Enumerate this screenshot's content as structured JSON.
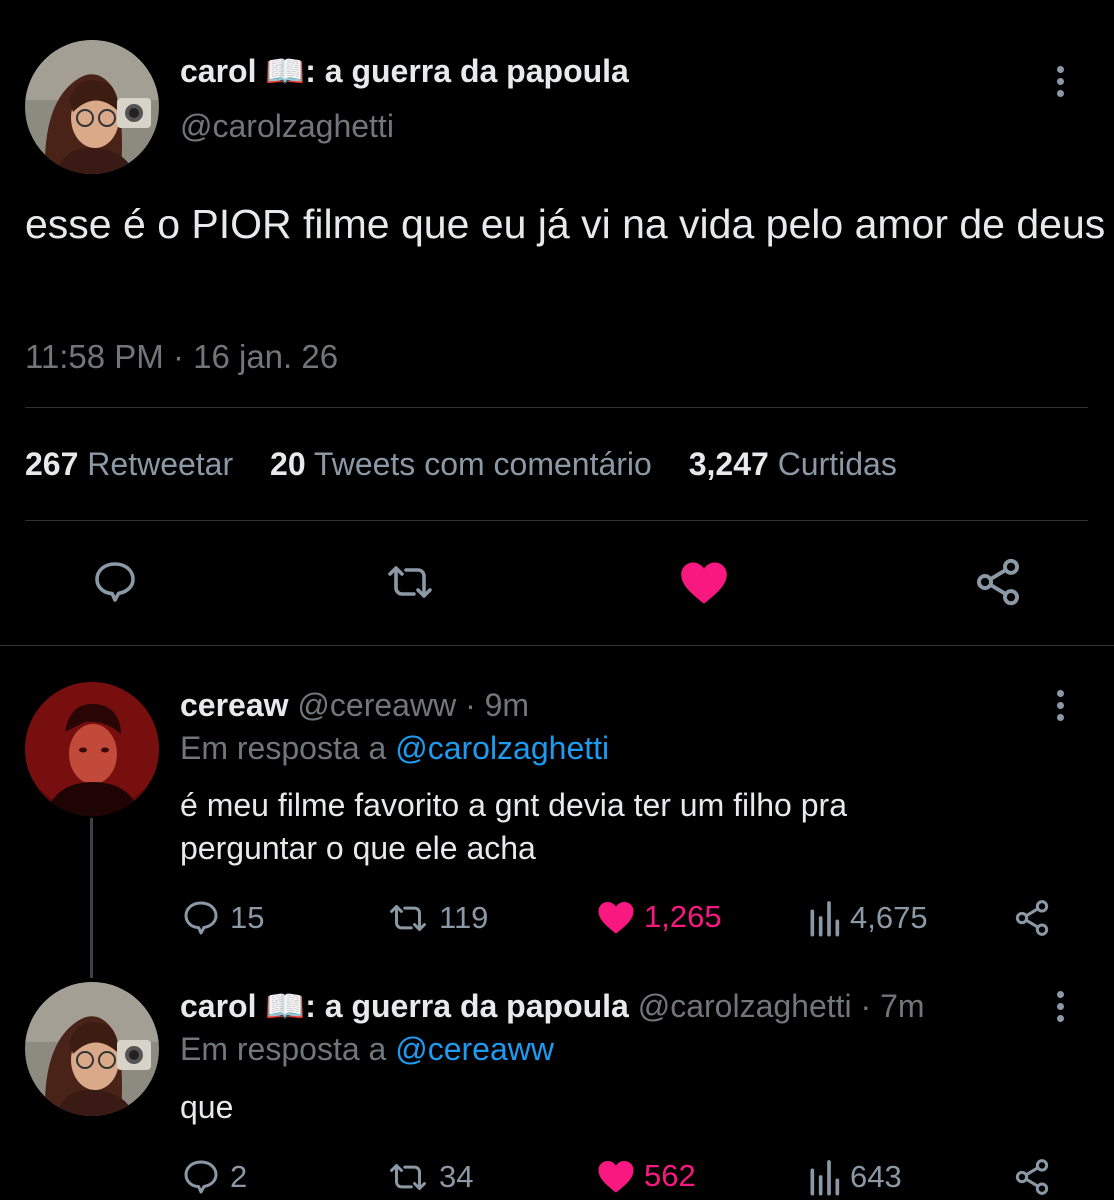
{
  "main_tweet": {
    "display_name": "carol 📖: a guerra da papoula",
    "handle": "@carolzaghetti",
    "text": "esse é o PIOR filme que eu já vi na vida pelo amor de deus",
    "timestamp": "11:58 PM · 16 jan. 26",
    "stats": {
      "retweets_count": "267",
      "retweets_label": "Retweetar",
      "quotes_count": "20",
      "quotes_label": "Tweets com comentário",
      "likes_count": "3,247",
      "likes_label": "Curtidas"
    },
    "liked": true
  },
  "replies": [
    {
      "display_name": "cereaw",
      "handle": "@cereaww",
      "time": "· 9m",
      "reply_prefix": "Em resposta a",
      "reply_to": "@carolzaghetti",
      "text": "é meu filme favorito a gnt devia ter um filho pra perguntar o que ele acha",
      "replies": "15",
      "retweets": "119",
      "likes": "1,265",
      "views": "4,675",
      "liked": true
    },
    {
      "display_name": "carol 📖: a guerra da papoula",
      "handle": "@carolzaghetti",
      "time": "· 7m",
      "reply_prefix": "Em resposta a",
      "reply_to": "@cereaww",
      "text": "que",
      "replies": "2",
      "retweets": "34",
      "likes": "562",
      "views": "643",
      "liked": true
    }
  ],
  "colors": {
    "background": "#000000",
    "text": "#e7e9ea",
    "muted": "#71767b",
    "link": "#1d9bf0",
    "like": "#f91880",
    "divider": "#2f3336"
  },
  "icons": [
    "more-icon",
    "reply-icon",
    "retweet-icon",
    "like-icon",
    "share-icon",
    "views-icon"
  ]
}
